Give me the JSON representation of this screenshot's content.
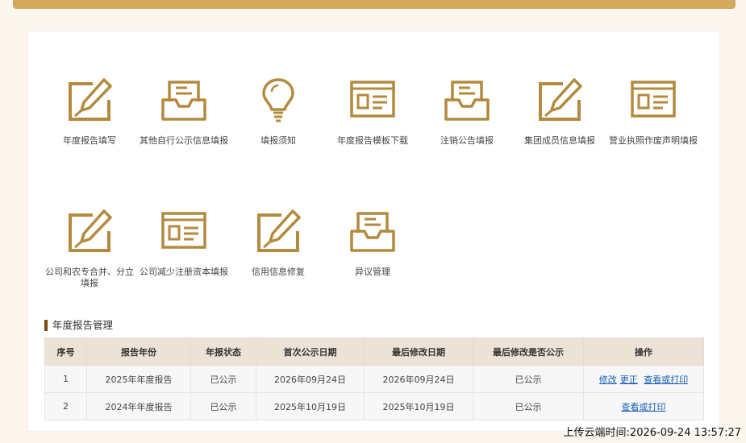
{
  "tiles": [
    {
      "label": "年度报告填写",
      "icon": "edit-icon"
    },
    {
      "label": "其他自行公示信息填报",
      "icon": "inbox-icon"
    },
    {
      "label": "填报须知",
      "icon": "lightbulb-icon"
    },
    {
      "label": "年度报告模板下载",
      "icon": "template-icon"
    },
    {
      "label": "注销公告填报",
      "icon": "inbox-icon"
    },
    {
      "label": "集团成员信息填报",
      "icon": "edit-icon"
    },
    {
      "label": "营业执照作废声明填报",
      "icon": "template-icon"
    },
    {
      "label": "公司和农专合并、分立填报",
      "icon": "edit-icon"
    },
    {
      "label": "公司减少注册资本填报",
      "icon": "template-icon"
    },
    {
      "label": "信用信息修复",
      "icon": "edit-icon"
    },
    {
      "label": "异议管理",
      "icon": "inbox-icon"
    }
  ],
  "section": {
    "title": "年度报告管理"
  },
  "table": {
    "headers": [
      "序号",
      "报告年份",
      "年报状态",
      "首次公示日期",
      "最后修改日期",
      "最后修改是否公示",
      "操作"
    ],
    "rows": [
      {
        "no": "1",
        "year": "2025年年度报告",
        "status": "已公示",
        "first": "2026年09月24日",
        "last": "2026年09月24日",
        "published": "已公示",
        "actions": [
          "修改",
          "更正",
          "查看或打印"
        ]
      },
      {
        "no": "2",
        "year": "2024年年度报告",
        "status": "已公示",
        "first": "2025年10月19日",
        "last": "2025年10月19日",
        "published": "已公示",
        "actions": [
          "查看或打印"
        ]
      }
    ]
  },
  "timestamp": "上传云端时间:2026-09-24 13:57:27",
  "colors": {
    "accent": "#b38a3e",
    "topbar": "#d4a95d"
  }
}
